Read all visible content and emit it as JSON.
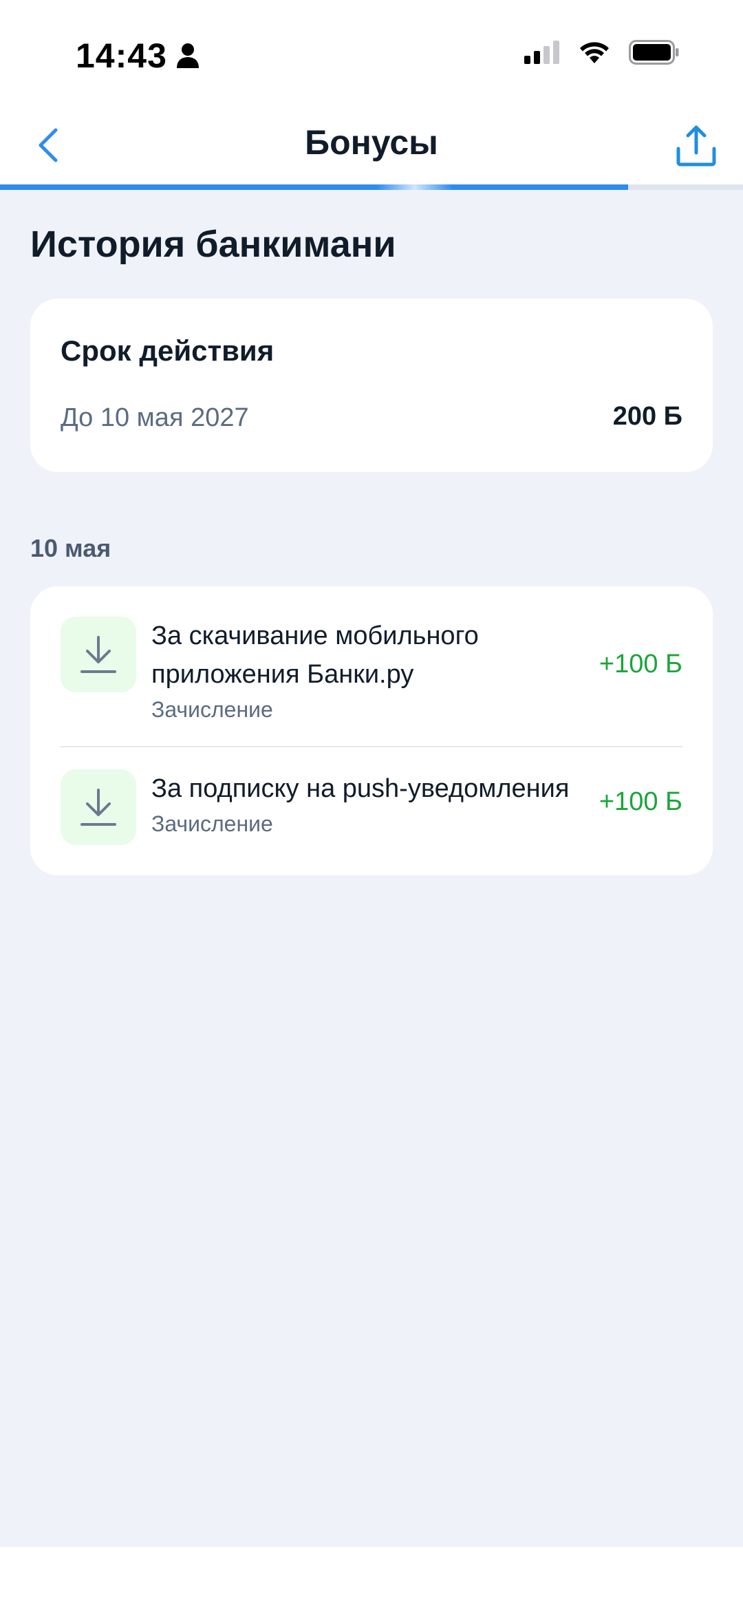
{
  "status_bar": {
    "time": "14:43",
    "icons": [
      "person-icon",
      "signal-icon",
      "wifi-icon",
      "battery-icon"
    ]
  },
  "nav": {
    "title": "Бонусы",
    "back_icon": "chevron-left-icon",
    "share_icon": "share-icon",
    "progress": 0.845,
    "accent_color": "#2f8cf0"
  },
  "page": {
    "heading": "История банкимани"
  },
  "validity": {
    "title": "Срок действия",
    "date": "До 10 мая 2027",
    "amount": "200 Б"
  },
  "history": {
    "date": "10 мая",
    "items": [
      {
        "title": "За скачивание мобильного приложения Банки.ру",
        "type": "Зачисление",
        "amount": "+100 Б",
        "icon": "download-icon"
      },
      {
        "title": "За подписку на push-уведомления",
        "type": "Зачисление",
        "amount": "+100 Б",
        "icon": "download-icon"
      }
    ],
    "amount_color": "#1aa53a"
  }
}
